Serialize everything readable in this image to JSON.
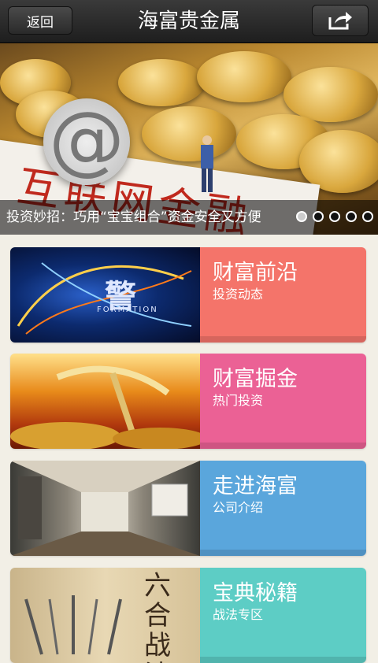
{
  "header": {
    "back_label": "返回",
    "title": "海富贵金属"
  },
  "banner": {
    "caption": "投资妙招：巧用“宝宝组合”资金安全又方便",
    "overlay_text": "互联网金融",
    "active_slide": 1,
    "slide_count": 5
  },
  "cards": [
    {
      "title": "财富前沿",
      "subtitle": "投资动态",
      "color": "#f4746a",
      "image_text": "FORMATION"
    },
    {
      "title": "财富掘金",
      "subtitle": "热门投资",
      "color": "#eb6195"
    },
    {
      "title": "走进海富",
      "subtitle": "公司介绍",
      "color": "#5aa6dc"
    },
    {
      "title": "宝典秘籍",
      "subtitle": "战法专区",
      "color": "#5dcdc5",
      "image_text": "六合战法"
    }
  ]
}
